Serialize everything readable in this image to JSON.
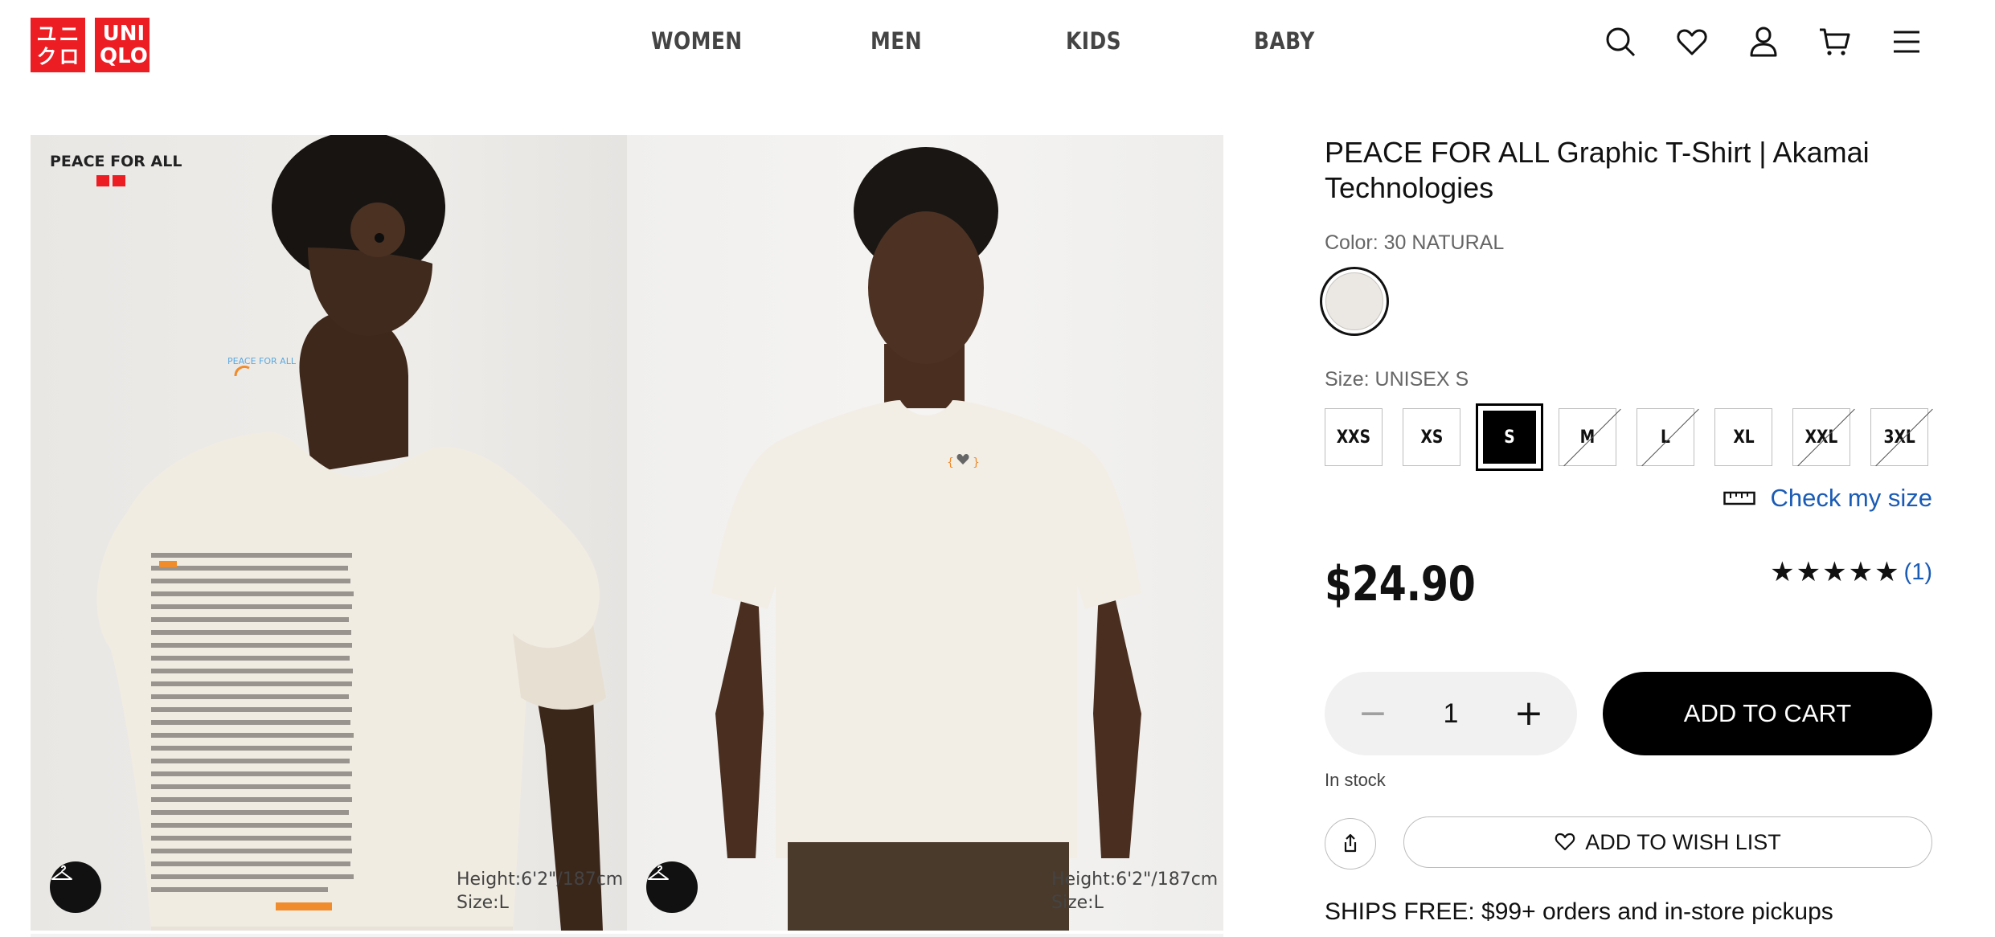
{
  "header": {
    "logo": {
      "line1": "ユニ",
      "line2": "クロ",
      "latin1": "UNI",
      "latin2": "QLO"
    },
    "nav": [
      "WOMEN",
      "MEN",
      "KIDS",
      "BABY"
    ],
    "icons": [
      "search-icon",
      "heart-icon",
      "user-icon",
      "cart-icon",
      "menu-icon"
    ]
  },
  "gallery": {
    "brand_tag": "PEACE FOR ALL",
    "photos": [
      {
        "model_height": "Height:6'2\"/187cm",
        "model_size": "Size:L"
      },
      {
        "model_height": "Height:6'2\"/187cm",
        "model_size": "Size:L"
      }
    ]
  },
  "product": {
    "title": "PEACE FOR ALL Graphic T-Shirt | Akamai Technologies",
    "color_label": "Color: 30 NATURAL",
    "color_swatch": "#ebe8e3",
    "size_label": "Size: UNISEX S",
    "sizes": [
      {
        "label": "XXS",
        "available": true
      },
      {
        "label": "XS",
        "available": true
      },
      {
        "label": "S",
        "available": true,
        "selected": true
      },
      {
        "label": "M",
        "available": false
      },
      {
        "label": "L",
        "available": false
      },
      {
        "label": "XL",
        "available": true
      },
      {
        "label": "XXL",
        "available": false
      },
      {
        "label": "3XL",
        "available": false
      }
    ],
    "check_size": "Check my size",
    "price": "$24.90",
    "rating": {
      "stars": "★★★★★",
      "value": 5,
      "count": "(1)"
    },
    "quantity": "1",
    "minus": "−",
    "plus": "+",
    "add_to_cart": "ADD TO CART",
    "stock": "In stock",
    "wish_list": "ADD TO WISH LIST",
    "shipping": "SHIPS FREE: $99+ orders and in-store pickups"
  },
  "colors": {
    "brand": "#ed1d24",
    "link": "#1a5bb5",
    "button": "#000000"
  }
}
